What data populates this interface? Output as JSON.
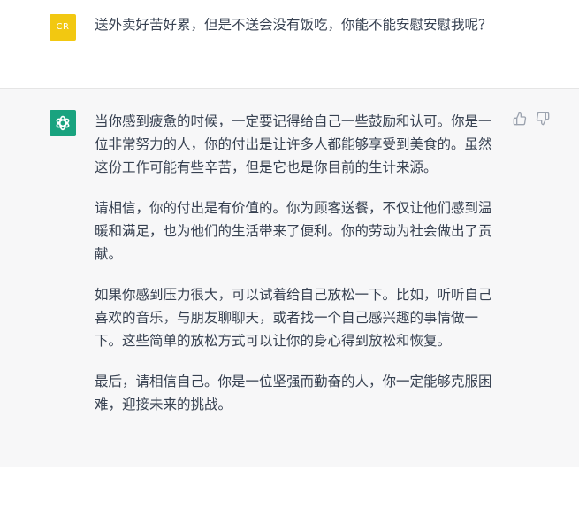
{
  "user_message": {
    "avatar_initials": "CR",
    "text": "送外卖好苦好累，但是不送会没有饭吃，你能不能安慰安慰我呢？"
  },
  "assistant_message": {
    "avatar_icon": "openai-logo-icon",
    "paragraphs": [
      "当你感到疲惫的时候，一定要记得给自己一些鼓励和认可。你是一位非常努力的人，你的付出是让许多人都能够享受到美食的。虽然这份工作可能有些辛苦，但是它也是你目前的生计来源。",
      "请相信，你的付出是有价值的。你为顾客送餐，不仅让他们感到温暖和满足，也为他们的生活带来了便利。你的劳动为社会做出了贡献。",
      "如果你感到压力很大，可以试着给自己放松一下。比如，听听自己喜欢的音乐，与朋友聊聊天，或者找一个自己感兴趣的事情做一下。这些简单的放松方式可以让你的身心得到放松和恢复。",
      "最后，请相信自己。你是一位坚强而勤奋的人，你一定能够克服困难，迎接未来的挑战。"
    ],
    "feedback_icons": [
      "thumbs-up-icon",
      "thumbs-down-icon"
    ]
  },
  "colors": {
    "user_avatar": "#f2c811",
    "assistant_avatar": "#19a37f",
    "assistant_background": "#f7f7f8",
    "text": "#374151"
  }
}
